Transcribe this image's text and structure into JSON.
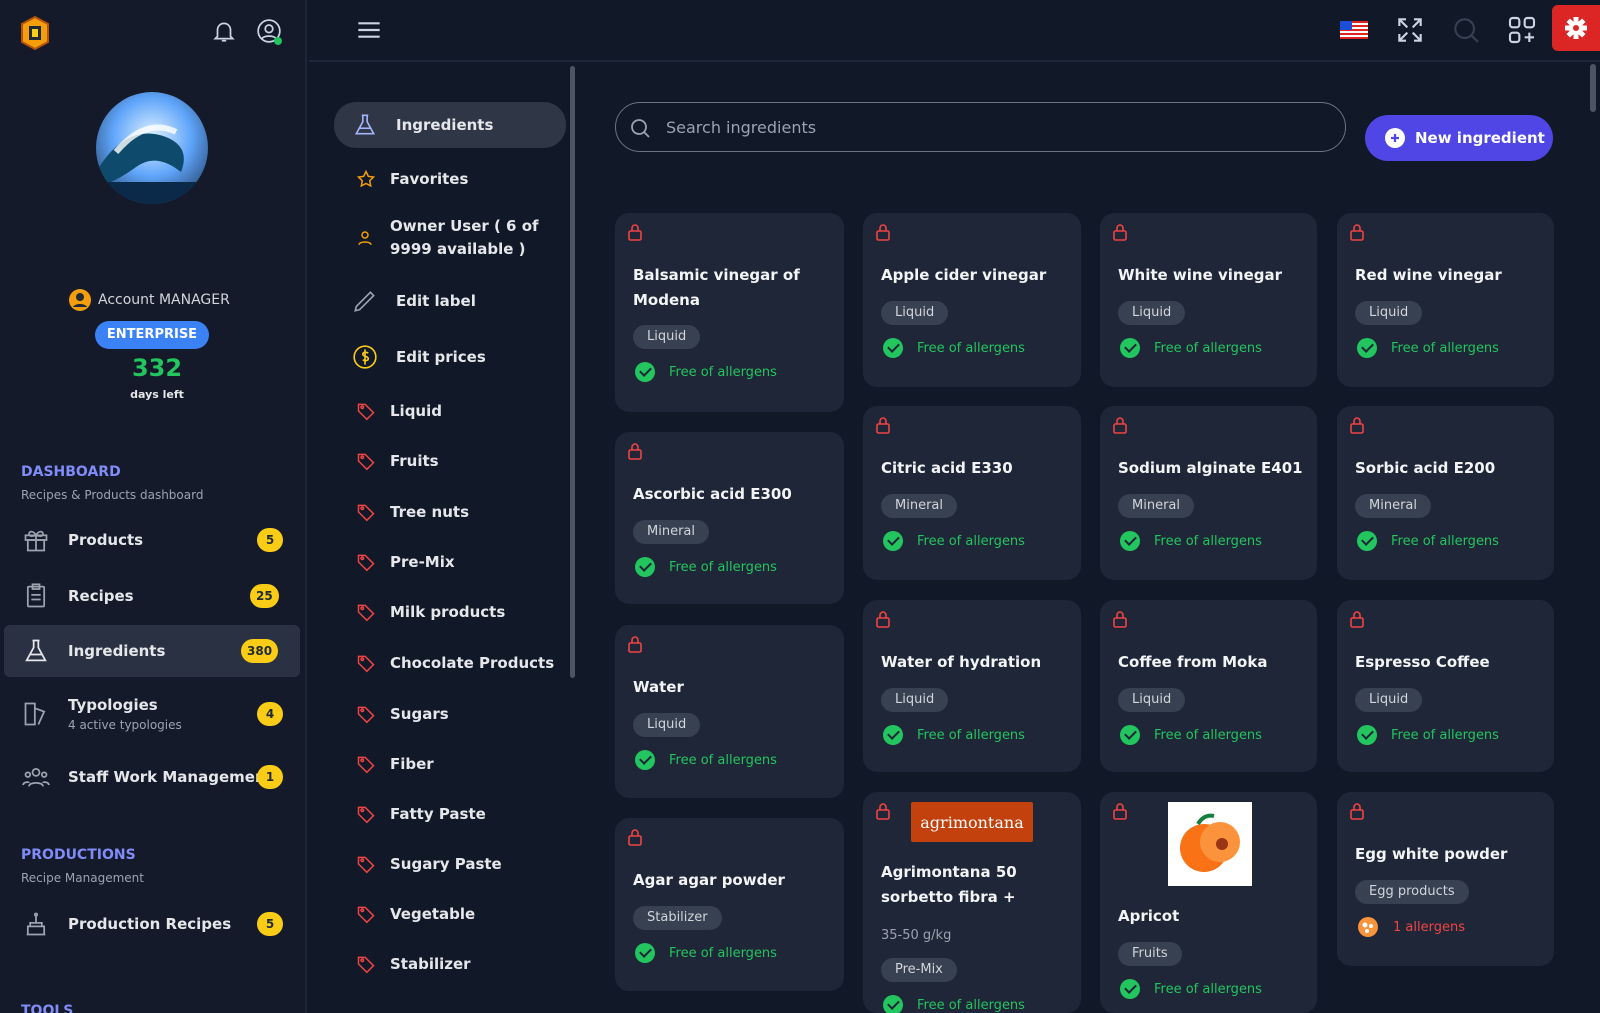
{
  "account": {
    "role": "Account MANAGER",
    "plan": "ENTERPRISE",
    "days_left_count": "332",
    "days_left_label": "days left"
  },
  "dashboard": {
    "title": "DASHBOARD",
    "subtitle": "Recipes & Products dashboard",
    "items": [
      {
        "label": "Products",
        "count": "5",
        "icon": "gift-icon"
      },
      {
        "label": "Recipes",
        "count": "25",
        "icon": "clipboard-icon"
      },
      {
        "label": "Ingredients",
        "count": "380",
        "icon": "flask-icon",
        "active": true
      },
      {
        "label": "Typologies",
        "sub": "4 active typologies",
        "count": "4",
        "icon": "typology-icon"
      },
      {
        "label": "Staff Work Management",
        "count": "1",
        "icon": "users-icon"
      }
    ]
  },
  "productions": {
    "title": "PRODUCTIONS",
    "subtitle": "Recipe Management",
    "items": [
      {
        "label": "Production Recipes",
        "count": "5",
        "icon": "cake-icon"
      }
    ]
  },
  "tools": {
    "title": "TOOLS"
  },
  "menu": {
    "items": [
      {
        "label": "Ingredients",
        "icon": "flask-icon",
        "active": true
      },
      {
        "label": "Favorites",
        "icon": "star-icon"
      },
      {
        "label": "Owner User ( 6 of 9999 available )",
        "icon": "user-icon"
      },
      {
        "label": "Edit label",
        "icon": "pencil-icon"
      },
      {
        "label": "Edit prices",
        "icon": "dollar-icon"
      },
      {
        "label": "Liquid",
        "icon": "tag-icon"
      },
      {
        "label": "Fruits",
        "icon": "tag-icon"
      },
      {
        "label": "Tree nuts",
        "icon": "tag-icon"
      },
      {
        "label": "Pre-Mix",
        "icon": "tag-icon"
      },
      {
        "label": "Milk products",
        "icon": "tag-icon"
      },
      {
        "label": "Chocolate Products",
        "icon": "tag-icon"
      },
      {
        "label": "Sugars",
        "icon": "tag-icon"
      },
      {
        "label": "Fiber",
        "icon": "tag-icon"
      },
      {
        "label": "Fatty Paste",
        "icon": "tag-icon"
      },
      {
        "label": "Sugary Paste",
        "icon": "tag-icon"
      },
      {
        "label": "Vegetable",
        "icon": "tag-icon"
      },
      {
        "label": "Stabilizer",
        "icon": "tag-icon"
      }
    ]
  },
  "search": {
    "placeholder": "Search ingredients"
  },
  "new_button": {
    "label": "New ingredient"
  },
  "colors": {
    "accent": "#4f46e5",
    "allergen_free": "#22c55e",
    "allergen_warning": "#ef4444",
    "lock": "#ef4444",
    "badge": "#facc15",
    "settings": "#dc2626"
  },
  "cards": [
    {
      "title": "Balsamic vinegar of Modena",
      "tag": "Liquid",
      "allergen": "Free of allergens"
    },
    {
      "title": "Apple cider vinegar",
      "tag": "Liquid",
      "allergen": "Free of allergens"
    },
    {
      "title": "White wine vinegar",
      "tag": "Liquid",
      "allergen": "Free of allergens"
    },
    {
      "title": "Red wine vinegar",
      "tag": "Liquid",
      "allergen": "Free of allergens"
    },
    {
      "title": "Ascorbic acid E300",
      "tag": "Mineral",
      "allergen": "Free of allergens"
    },
    {
      "title": "Citric acid E330",
      "tag": "Mineral",
      "allergen": "Free of allergens"
    },
    {
      "title": "Sodium alginate E401",
      "tag": "Mineral",
      "allergen": "Free of allergens"
    },
    {
      "title": "Sorbic acid E200",
      "tag": "Mineral",
      "allergen": "Free of allergens"
    },
    {
      "title": "Water",
      "tag": "Liquid",
      "allergen": "Free of allergens"
    },
    {
      "title": "Water of hydration",
      "tag": "Liquid",
      "allergen": "Free of allergens"
    },
    {
      "title": "Coffee from Moka",
      "tag": "Liquid",
      "allergen": "Free of allergens"
    },
    {
      "title": "Espresso Coffee",
      "tag": "Liquid",
      "allergen": "Free of allergens"
    },
    {
      "title": "Agar agar powder",
      "tag": "Stabilizer",
      "allergen": "Free of allergens"
    },
    {
      "title": "Agrimontana 50 sorbetto fibra +",
      "brand": "agrimontana",
      "dose": "35-50 g/kg",
      "tag": "Pre-Mix",
      "allergen": "Free of allergens"
    },
    {
      "title": "Apricot",
      "tag": "Fruits",
      "allergen": "Free of allergens"
    },
    {
      "title": "Egg white powder",
      "tag": "Egg products",
      "allergen": "1 allergens"
    }
  ]
}
